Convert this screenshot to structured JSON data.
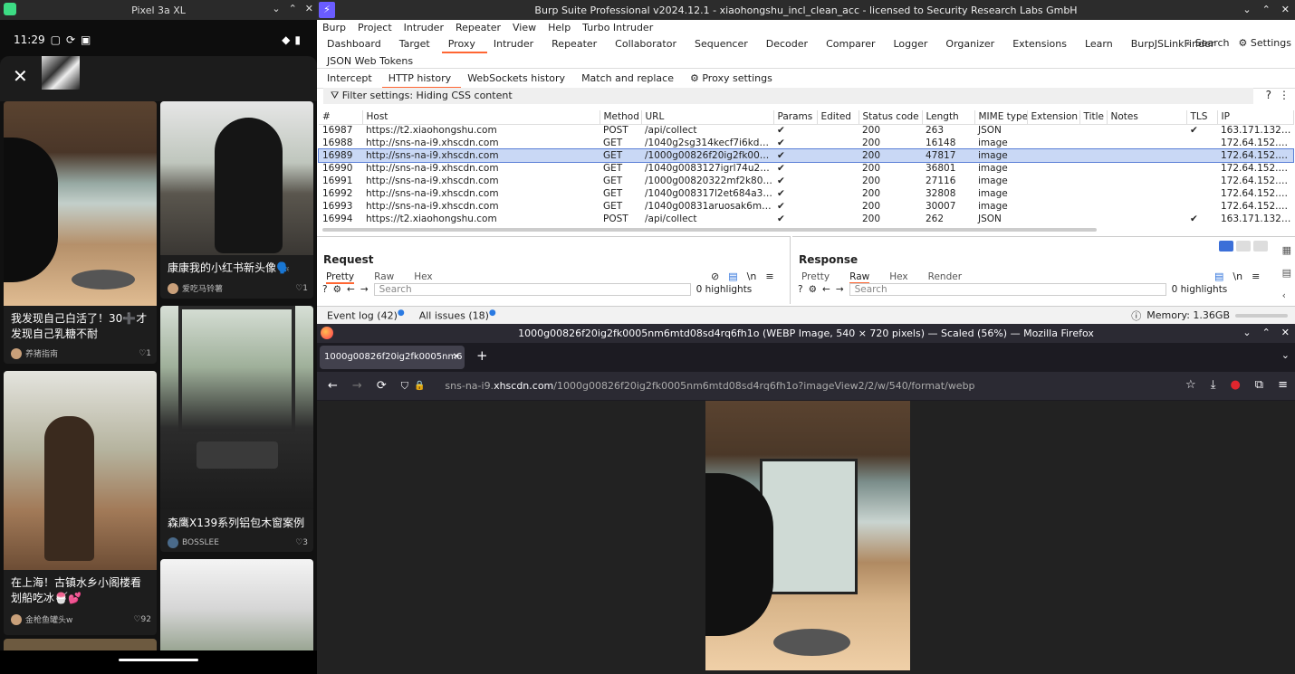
{
  "emulator": {
    "title": "Pixel 3a XL",
    "controls": [
      "⌄",
      "⌃",
      "✕"
    ]
  },
  "phone": {
    "time": "11:29",
    "status_icons": [
      "▢",
      "⟳",
      "▣"
    ],
    "status_right": [
      "◆",
      "▮"
    ],
    "close_symbol": "✕",
    "cards": [
      {
        "caption": "",
        "author": "",
        "likes": ""
      },
      {
        "caption": "康康我的小红书新头像🗣️",
        "author": "爱吃马铃薯",
        "likes": "♡1"
      },
      {
        "caption": "我发现自己白活了！30➕才发现自己乳糖不耐",
        "author": "养猪指南",
        "likes": "♡1"
      },
      {
        "caption": "森鹰X139系列铝包木窗案例",
        "author": "BOSSLEE",
        "likes": "♡3"
      },
      {
        "caption": "在上海！古镇水乡小阁楼看划船吃冰🍧💕",
        "author": "金枪鱼罐头w",
        "likes": "♡92"
      }
    ]
  },
  "burp": {
    "title": "Burp Suite Professional v2024.12.1 - xiaohongshu_incl_clean_acc - licensed to Security Research Labs GmbH",
    "logo": "⚡",
    "window_controls": [
      "⌄",
      "⌃",
      "✕"
    ],
    "menu": [
      "Burp",
      "Project",
      "Intruder",
      "Repeater",
      "View",
      "Help",
      "Turbo Intruder"
    ],
    "tabs": [
      "Dashboard",
      "Target",
      "Proxy",
      "Intruder",
      "Repeater",
      "Collaborator",
      "Sequencer",
      "Decoder",
      "Comparer",
      "Logger",
      "Organizer",
      "Extensions",
      "Learn",
      "BurpJSLinkFinder"
    ],
    "search_label": "Search",
    "settings_label": "Settings",
    "extra_tab": "JSON Web Tokens",
    "proxy_tabs": [
      "Intercept",
      "HTTP history",
      "WebSockets history",
      "Match and replace",
      "Proxy settings"
    ],
    "filter_text": "Filter settings: Hiding CSS content",
    "filter_icons": [
      "?",
      "⋮"
    ],
    "columns": [
      "#",
      "Host",
      "Method",
      "URL",
      "Params",
      "Edited",
      "Status code",
      "Length",
      "MIME type",
      "Extension",
      "Title",
      "Notes",
      "TLS",
      "IP"
    ],
    "rows": [
      [
        "16987",
        "https://t2.xiaohongshu.com",
        "POST",
        "/api/collect",
        "✔",
        "",
        "200",
        "263",
        "JSON",
        "",
        "",
        "",
        "✔",
        "163.171.132.60"
      ],
      [
        "16988",
        "http://sns-na-i9.xhscdn.com",
        "GET",
        "/1040g2sg314kecf7i6kdg5pi...",
        "✔",
        "",
        "200",
        "16148",
        "image",
        "",
        "",
        "",
        "",
        "172.64.152.254"
      ],
      [
        "16989",
        "http://sns-na-i9.xhscdn.com",
        "GET",
        "/1000g00826f20ig2fk0005n...",
        "✔",
        "",
        "200",
        "47817",
        "image",
        "",
        "",
        "",
        "",
        "172.64.152.254"
      ],
      [
        "16990",
        "http://sns-na-i9.xhscdn.com",
        "GET",
        "/1040g0083127igrl74u2g5oi...",
        "✔",
        "",
        "200",
        "36801",
        "image",
        "",
        "",
        "",
        "",
        "172.64.152.254"
      ],
      [
        "16991",
        "http://sns-na-i9.xhscdn.com",
        "GET",
        "/1000g00820322mf2k8030...",
        "✔",
        "",
        "200",
        "27116",
        "image",
        "",
        "",
        "",
        "",
        "172.64.152.254"
      ],
      [
        "16992",
        "http://sns-na-i9.xhscdn.com",
        "GET",
        "/1040g008317l2et684a305...",
        "✔",
        "",
        "200",
        "32808",
        "image",
        "",
        "",
        "",
        "",
        "172.64.152.254"
      ],
      [
        "16993",
        "http://sns-na-i9.xhscdn.com",
        "GET",
        "/1040g00831aruosak6m0g...",
        "✔",
        "",
        "200",
        "30007",
        "image",
        "",
        "",
        "",
        "",
        "172.64.152.254"
      ],
      [
        "16994",
        "https://t2.xiaohongshu.com",
        "POST",
        "/api/collect",
        "✔",
        "",
        "200",
        "262",
        "JSON",
        "",
        "",
        "",
        "✔",
        "163.171.132.60"
      ]
    ],
    "selected_row": 2,
    "request": {
      "title": "Request",
      "tabs": [
        "Pretty",
        "Raw",
        "Hex"
      ],
      "search_placeholder": "Search",
      "highlights": "0 highlights",
      "icons": [
        "⊘",
        "▤",
        "\\n",
        "≡"
      ]
    },
    "response": {
      "title": "Response",
      "tabs": [
        "Pretty",
        "Raw",
        "Hex",
        "Render"
      ],
      "search_placeholder": "Search",
      "highlights": "0 highlights",
      "icons": [
        "▤",
        "\\n",
        "≡"
      ]
    },
    "event_log": "Event log (42)",
    "all_issues": "All issues (18)",
    "memory": "Memory: 1.36GB",
    "colors": {
      "accent": "#ff6633",
      "selection": "#c9d8f5"
    }
  },
  "firefox": {
    "title": "1000g00826f20ig2fk0005nm6mtd08sd4rq6fh1o (WEBP Image, 540 × 720 pixels) — Scaled (56%) — Mozilla Firefox",
    "window_controls": [
      "⌄",
      "⌃",
      "✕"
    ],
    "tab_label": "1000g00826f20ig2fk0005nm6",
    "tab_close": "✕",
    "new_tab": "+",
    "tabs_dropdown": "⌄",
    "nav_icons": [
      "←",
      "→",
      "⟳",
      "⛉",
      "🔒"
    ],
    "url_domain_prefix": "sns-na-i9.",
    "url_domain": "xhscdn.com",
    "url_path": "/1000g00826f20ig2fk0005nm6mtd08sd4rq6fh1o?imageView2/2/w/540/format/webp",
    "toolbar_icons": [
      "☆",
      "⤓",
      "●",
      "⧉",
      "≡"
    ]
  }
}
